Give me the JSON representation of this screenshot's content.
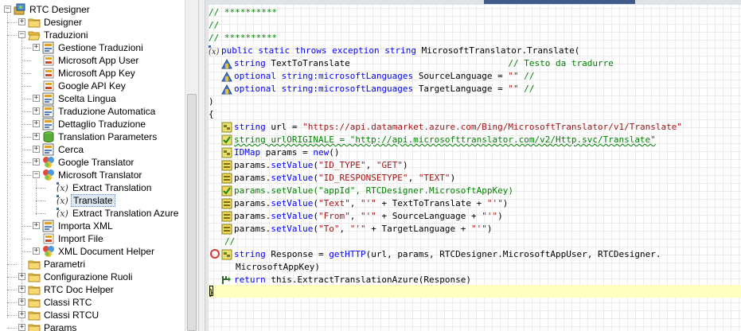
{
  "tree": {
    "items": [
      {
        "label": "RTC Designer",
        "expander": "−",
        "icon": "project-icon"
      },
      {
        "label": "Designer",
        "expander": "+",
        "icon": "folder-icon"
      },
      {
        "label": "Traduzioni",
        "expander": "−",
        "icon": "folder-open-icon"
      },
      {
        "label": "Gestione Traduzioni",
        "expander": "+",
        "icon": "form-icon"
      },
      {
        "label": "Microsoft App User",
        "expander": "",
        "icon": "property-icon"
      },
      {
        "label": "Microsoft App Key",
        "expander": "",
        "icon": "property-icon"
      },
      {
        "label": "Google API Key",
        "expander": "",
        "icon": "property-icon"
      },
      {
        "label": "Scelta Lingua",
        "expander": "+",
        "icon": "form-icon"
      },
      {
        "label": "Traduzione Automatica",
        "expander": "+",
        "icon": "form-icon"
      },
      {
        "label": "Dettaglio Traduzione",
        "expander": "+",
        "icon": "form-icon"
      },
      {
        "label": "Translation Parameters",
        "expander": "+",
        "icon": "database-icon"
      },
      {
        "label": "Cerca",
        "expander": "+",
        "icon": "form-icon"
      },
      {
        "label": "Google Translator",
        "expander": "+",
        "icon": "library-icon"
      },
      {
        "label": "Microsoft Translator",
        "expander": "−",
        "icon": "library-icon"
      },
      {
        "label": "Extract Translation",
        "expander": "",
        "icon": "function-icon"
      },
      {
        "label": "Translate",
        "expander": "",
        "icon": "function-icon"
      },
      {
        "label": "Extract Translation Azure",
        "expander": "",
        "icon": "function-icon"
      },
      {
        "label": "Importa XML",
        "expander": "+",
        "icon": "form-icon"
      },
      {
        "label": "Import File",
        "expander": "",
        "icon": "property-icon"
      },
      {
        "label": "XML Document Helper",
        "expander": "+",
        "icon": "library-icon"
      },
      {
        "label": "Parametri",
        "expander": "",
        "icon": "folder-icon"
      },
      {
        "label": "Configurazione Ruoli",
        "expander": "+",
        "icon": "folder-icon"
      },
      {
        "label": "RTC Doc Helper",
        "expander": "+",
        "icon": "folder-icon"
      },
      {
        "label": "Classi RTC",
        "expander": "+",
        "icon": "folder-icon"
      },
      {
        "label": "Classi RTCU",
        "expander": "+",
        "icon": "folder-icon"
      },
      {
        "label": "Params",
        "expander": "+",
        "icon": "folder-icon"
      }
    ]
  },
  "editor": {
    "lines": [
      {
        "icon": "",
        "parts": [
          [
            "cm",
            "// **********"
          ]
        ]
      },
      {
        "icon": "",
        "parts": [
          [
            "cm",
            "//"
          ]
        ]
      },
      {
        "icon": "",
        "parts": [
          [
            "cm",
            "// **********"
          ]
        ]
      },
      {
        "icon": "method-icon",
        "parts": [
          [
            "kw",
            "public static throws exception string "
          ],
          [
            "",
            "MicrosoftTranslator.Translate("
          ]
        ]
      },
      {
        "icon": "param-icon",
        "parts": [
          [
            "kw",
            "string "
          ],
          [
            "",
            "TextToTranslate                              "
          ],
          [
            "cm",
            "// Testo da tradurre"
          ]
        ]
      },
      {
        "icon": "param-icon",
        "parts": [
          [
            "kw",
            "optional string"
          ],
          [
            "",
            ":"
          ],
          [
            "kw",
            "microsoftLanguages "
          ],
          [
            "",
            "SourceLanguage = "
          ],
          [
            "str",
            "\"\""
          ],
          [
            "cm",
            " //"
          ]
        ]
      },
      {
        "icon": "param-icon",
        "parts": [
          [
            "kw",
            "optional string"
          ],
          [
            "",
            ":"
          ],
          [
            "kw",
            "microsoftLanguages "
          ],
          [
            "",
            "TargetLanguage = "
          ],
          [
            "str",
            "\"\""
          ],
          [
            "cm",
            " //"
          ]
        ]
      },
      {
        "icon": "",
        "parts": [
          [
            "",
            ")"
          ]
        ]
      },
      {
        "icon": "",
        "parts": [
          [
            "",
            "{"
          ]
        ]
      },
      {
        "icon": "var-icon",
        "parts": [
          [
            "kw",
            "string "
          ],
          [
            "",
            "url = "
          ],
          [
            "str",
            "\"https://api.datamarket.azure.com/Bing/MicrosoftTranslator/v1/Translate\""
          ]
        ]
      },
      {
        "icon": "var-check-icon",
        "parts": [
          [
            "cm squig",
            "string urlORIGINALE = \"http://api.microsofttranslator.com/v2/Http.svc/Translate\""
          ]
        ]
      },
      {
        "icon": "var-icon",
        "parts": [
          [
            "kw",
            "IDMap "
          ],
          [
            "",
            "params = "
          ],
          [
            "kw",
            "new"
          ],
          [
            "",
            "()"
          ]
        ]
      },
      {
        "icon": "stmt-icon",
        "parts": [
          [
            "",
            "params."
          ],
          [
            "kw",
            "setValue"
          ],
          [
            "",
            "("
          ],
          [
            "str",
            "\"ID_TYPE\""
          ],
          [
            "",
            ", "
          ],
          [
            "str",
            "\"GET\""
          ],
          [
            "",
            ")"
          ]
        ]
      },
      {
        "icon": "stmt-icon",
        "parts": [
          [
            "",
            "params."
          ],
          [
            "kw",
            "setValue"
          ],
          [
            "",
            "("
          ],
          [
            "str",
            "\"ID_RESPONSETYPE\""
          ],
          [
            "",
            ", "
          ],
          [
            "str",
            "\"TEXT\""
          ],
          [
            "",
            ")"
          ]
        ]
      },
      {
        "icon": "stmt-check-icon",
        "parts": [
          [
            "cm",
            "params.setValue(\"appId\", RTCDesigner.MicrosoftAppKey)"
          ]
        ]
      },
      {
        "icon": "stmt-icon",
        "parts": [
          [
            "",
            "params."
          ],
          [
            "kw",
            "setValue"
          ],
          [
            "",
            "("
          ],
          [
            "str",
            "\"Text\""
          ],
          [
            "",
            ", "
          ],
          [
            "str",
            "\"'\""
          ],
          [
            "",
            " + TextToTranslate + "
          ],
          [
            "str",
            "\"'\""
          ],
          [
            "",
            ")"
          ]
        ]
      },
      {
        "icon": "stmt-icon",
        "parts": [
          [
            "",
            "params."
          ],
          [
            "kw",
            "setValue"
          ],
          [
            "",
            "("
          ],
          [
            "str",
            "\"From\""
          ],
          [
            "",
            ", "
          ],
          [
            "str",
            "\"'\""
          ],
          [
            "",
            " + SourceLanguage + "
          ],
          [
            "str",
            "\"'\""
          ],
          [
            "",
            ")"
          ]
        ]
      },
      {
        "icon": "stmt-icon",
        "parts": [
          [
            "",
            "params."
          ],
          [
            "kw",
            "setValue"
          ],
          [
            "",
            "("
          ],
          [
            "str",
            "\"To\""
          ],
          [
            "",
            ", "
          ],
          [
            "str",
            "\"'\""
          ],
          [
            "",
            " + TargetLanguage + "
          ],
          [
            "str",
            "\"'\""
          ],
          [
            "",
            ")"
          ]
        ]
      },
      {
        "icon": "",
        "parts": [
          [
            "cm",
            "//"
          ]
        ]
      },
      {
        "icon": "var-icon",
        "parts": [
          [
            "kw",
            "string "
          ],
          [
            "",
            "Response = "
          ],
          [
            "kw",
            "getHTTP"
          ],
          [
            "",
            "(url, params, RTCDesigner.MicrosoftAppUser, RTCDesigner."
          ]
        ]
      },
      {
        "icon": "",
        "parts": [
          [
            "",
            "MicrosoftAppKey)"
          ]
        ]
      },
      {
        "icon": "return-icon",
        "parts": [
          [
            "kw",
            "return "
          ],
          [
            "",
            "this.ExtractTranslationAzure(Response)"
          ]
        ]
      },
      {
        "icon": "",
        "parts": [
          [
            "",
            "}"
          ]
        ]
      }
    ]
  },
  "colors": {
    "keyword": "#0000ff",
    "string": "#a31515",
    "comment": "#008000",
    "selection": "#dde8f3",
    "current_line": "#ffffc0",
    "breakpoint": "#d33333"
  }
}
